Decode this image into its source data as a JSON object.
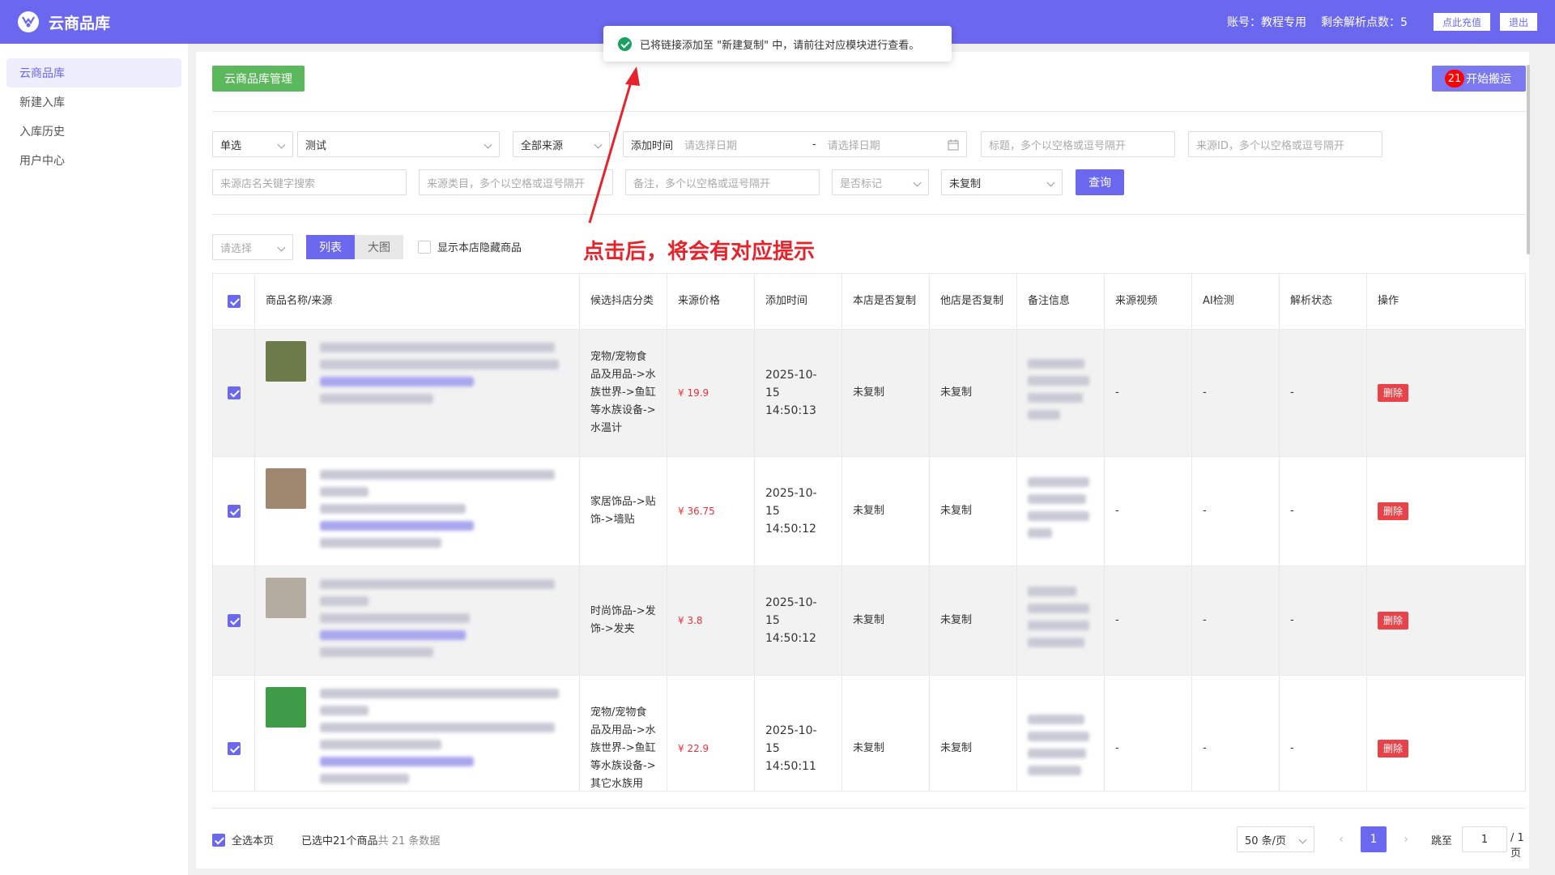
{
  "header": {
    "app_title": "云商品库",
    "account": "账号：教程专用",
    "remaining": "剩余解析点数：5",
    "recharge": "点此充值",
    "logout": "退出"
  },
  "sidebar": {
    "items": [
      {
        "label": "云商品库"
      },
      {
        "label": "新建入库"
      },
      {
        "label": "入库历史"
      },
      {
        "label": "用户中心"
      }
    ]
  },
  "toolbar": {
    "manage": "云商品库管理",
    "start": "开始搬运",
    "badge": "21"
  },
  "filters": {
    "select_mode": "单选",
    "shop": "测试",
    "source": "全部来源",
    "date_label": "添加时间",
    "date_start_ph": "请选择日期",
    "date_sep": "-",
    "date_end_ph": "请选择日期",
    "title_ph": "标题，多个以空格或逗号隔开",
    "source_id_ph": "来源ID，多个以空格或逗号隔开",
    "shop_keyword_ph": "来源店名关键字搜索",
    "category_ph": "来源类目，多个以空格或逗号隔开",
    "note_ph": "备注，多个以空格或逗号隔开",
    "marked_ph": "是否标记",
    "copy_status": "未复制",
    "query": "查询"
  },
  "view": {
    "select_ph": "请选择",
    "list": "列表",
    "grid": "大图",
    "show_hidden": "显示本店隐藏商品"
  },
  "table": {
    "headers": {
      "name": "商品名称/来源",
      "category": "候选抖店分类",
      "price": "来源价格",
      "time": "添加时间",
      "this_copy": "本店是否复制",
      "other_copy": "他店是否复制",
      "note": "备注信息",
      "video": "来源视频",
      "ai": "AI检测",
      "parse": "解析状态",
      "ops": "操作"
    },
    "rows": [
      {
        "category": "宠物/宠物食品及用品->水族世界->鱼缸等水族设备->水温计",
        "price": "¥ 19.9",
        "time": "2025-10-15 14:50:13",
        "this_copy": "未复制",
        "other_copy": "未复制",
        "video": "-",
        "ai": "-",
        "parse": "-",
        "op": "删除",
        "thumb_color": "#6d7a4a"
      },
      {
        "category": "家居饰品->贴饰->墙贴",
        "price": "¥ 36.75",
        "time": "2025-10-15 14:50:12",
        "this_copy": "未复制",
        "other_copy": "未复制",
        "video": "-",
        "ai": "-",
        "parse": "-",
        "op": "删除",
        "thumb_color": "#a08770"
      },
      {
        "category": "时尚饰品->发饰->发夹",
        "price": "¥ 3.8",
        "time": "2025-10-15 14:50:12",
        "this_copy": "未复制",
        "other_copy": "未复制",
        "video": "-",
        "ai": "-",
        "parse": "-",
        "op": "删除",
        "thumb_color": "#b5aca1"
      },
      {
        "category": "宠物/宠物食品及用品->水族世界->鱼缸等水族设备->其它水族用",
        "price": "¥ 22.9",
        "time": "2025-10-15 14:50:11",
        "this_copy": "未复制",
        "other_copy": "未复制",
        "video": "-",
        "ai": "-",
        "parse": "-",
        "op": "删除",
        "thumb_color": "#3f9b48"
      }
    ]
  },
  "footer": {
    "select_page": "全选本页",
    "selected": "已选中21个商品",
    "total": "共 21 条数据",
    "page_size": "50 条/页",
    "prev": "‹",
    "page": "1",
    "next": "›",
    "jump": "跳至",
    "jump_value": "1",
    "pages": "/ 1 页"
  },
  "toast": {
    "message": "已将链接添加至 \"新建复制\" 中，请前往对应模块进行查看。"
  },
  "annotation": "点击后，将会有对应提示"
}
